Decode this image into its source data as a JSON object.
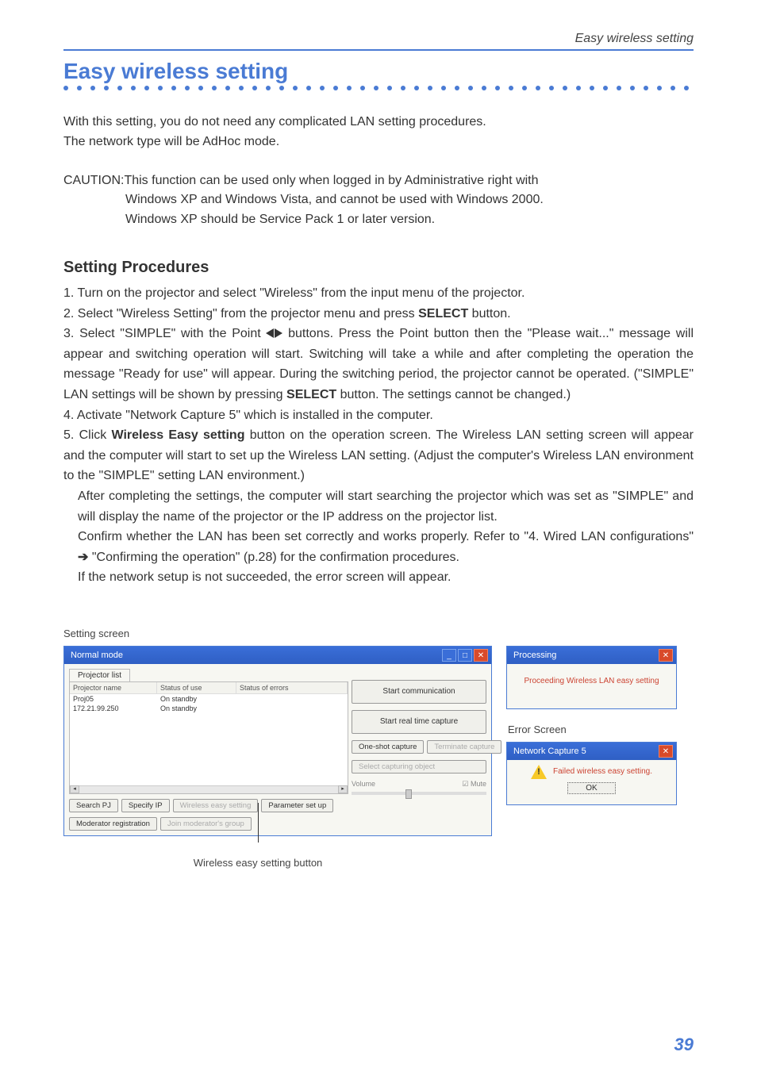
{
  "header": {
    "page_context": "Easy wireless setting"
  },
  "heading": "Easy wireless setting",
  "intro": {
    "p1": "With this setting, you do not need any complicated LAN setting procedures.",
    "p2": "The network type will be AdHoc mode."
  },
  "caution": {
    "label": "CAUTION: ",
    "l1": "This function can be used only when logged in by Administrative right with",
    "l2": "Windows XP and Windows Vista, and cannot be used with Windows 2000.",
    "l3": "Windows XP should be Service Pack 1 or later version."
  },
  "procedures_heading": "Setting Procedures",
  "steps": {
    "s1": "1. Turn on the projector and select \"Wireless\" from the input menu of the projector.",
    "s2_a": "2. Select \"Wireless Setting\" from the projector menu and press ",
    "s2_b": " button.",
    "select_bold": "SELECT",
    "s3_a": "3. Select \"SIMPLE\" with the Point ",
    "s3_b": " buttons. Press the Point button then the \"Please wait...\" message will appear and switching operation will start. Switching will take a while and after completing the operation the message \"Ready for use\" will appear. During the switching period, the projector cannot be operated. (\"SIMPLE\" LAN settings will be shown by pressing ",
    "s3_c": " button. The settings cannot be changed.)",
    "s4": "4. Activate \"Network Capture 5\" which is installed in the computer.",
    "s5_a": "5. Click ",
    "s5_bold": "Wireless Easy setting",
    "s5_b": " button on the operation screen. The Wireless LAN setting screen will appear and the computer will start to set up the Wireless LAN setting. (Adjust the computer's Wireless LAN environment to the \"SIMPLE\" setting LAN environment.)",
    "s5_c": "After completing the settings, the computer will start searching the projector which was set as \"SIMPLE\" and will display the name of the projector or the IP address on the projector list.",
    "s5_d_a": "Confirm whether the LAN has been set correctly and works properly. Refer to \"4. Wired LAN configurations\" ",
    "s5_d_b": " \"Confirming the operation\" (p.28) for the confirmation procedures.",
    "s5_e": "If the network setup is not succeeded, the error screen will appear."
  },
  "setting_screen_label": "Setting screen",
  "app": {
    "title": "Normal mode",
    "tab": "Projector list",
    "cols": {
      "name": "Projector name",
      "status": "Status of use",
      "errors": "Status of errors"
    },
    "rows": [
      {
        "name": "Proj05",
        "status": "On standby"
      },
      {
        "name": "172.21.99.250",
        "status": "On standby"
      }
    ],
    "buttons": {
      "search": "Search PJ",
      "specify": "Specify IP",
      "wireless_easy": "Wireless easy setting",
      "param": "Parameter set up",
      "mod_reg": "Moderator registration",
      "join_mod": "Join moderator's group"
    },
    "right": {
      "start_comm": "Start communication",
      "start_real": "Start real time capture",
      "oneshot": "One-shot capture",
      "terminate": "Terminate capture",
      "select_cap": "Select capturing object",
      "volume": "Volume",
      "mute": "Mute"
    }
  },
  "proc_win": {
    "title": "Processing",
    "msg": "Proceeding Wireless LAN easy setting"
  },
  "error_screen_label": "Error Screen",
  "err_win": {
    "title": "Network Capture 5",
    "msg": "Failed wireless easy setting.",
    "ok": "OK"
  },
  "callout": "Wireless easy setting button",
  "page_number": "39"
}
